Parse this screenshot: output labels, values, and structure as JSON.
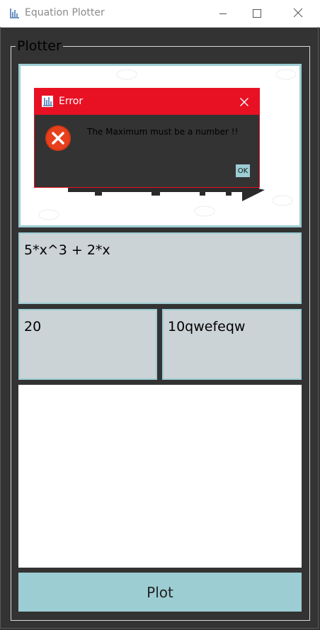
{
  "window": {
    "title": "Equation Plotter"
  },
  "plotter": {
    "group_title": "Plotter",
    "equation_value": "5*x^3 + 2*x",
    "minimum_value": "20",
    "maximum_value": "10qwefeqw",
    "plot_label": "Plot"
  },
  "dialog": {
    "title": "Error",
    "message": "The Maximum must be a number !!",
    "ok_label": "OK"
  },
  "icons": {
    "app": "chart-icon",
    "minimize": "minimize-icon",
    "maximize": "maximize-icon",
    "close": "close-icon",
    "error": "error-icon"
  },
  "colors": {
    "background": "#333333",
    "accent": "#9ccdd3",
    "field": "#ccd3d7",
    "error_red": "#e81123"
  }
}
